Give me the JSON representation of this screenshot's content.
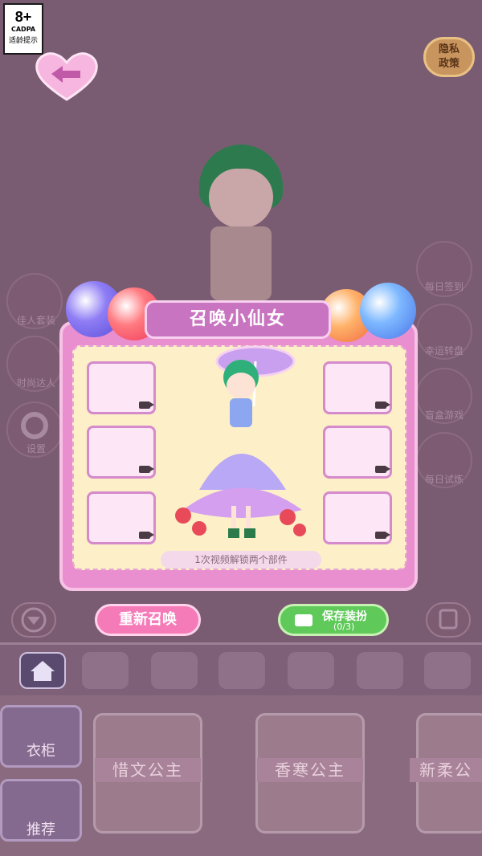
{
  "age_rating": {
    "number": "8+",
    "org": "CADPA",
    "tip": "适龄提示"
  },
  "privacy": {
    "line1": "隐私",
    "line2": "政策"
  },
  "left_menu": [
    {
      "label": "佳人套装"
    },
    {
      "label": "时尚达人"
    },
    {
      "label": "设置"
    }
  ],
  "right_menu": [
    {
      "label": "每日签到"
    },
    {
      "label": "幸运转盘"
    },
    {
      "label": "盲盒游戏"
    },
    {
      "label": "每日试炼"
    }
  ],
  "popup": {
    "title": "召唤小仙女",
    "hint": "1次视频解锁两个部件",
    "resummon": "重新召唤",
    "save_label": "保存装扮",
    "save_count": "(0/3)"
  },
  "wardrobe": {
    "label": "衣柜"
  },
  "recommend": {
    "label": "推荐"
  },
  "cards": [
    {
      "label": "惜文公主"
    },
    {
      "label": "香寒公主"
    },
    {
      "label": "新柔公"
    }
  ],
  "colors": {
    "popup": "#e98fd0",
    "title_banner": "#c874c0",
    "resummon": "#f57ab8",
    "save": "#5fc95a"
  }
}
